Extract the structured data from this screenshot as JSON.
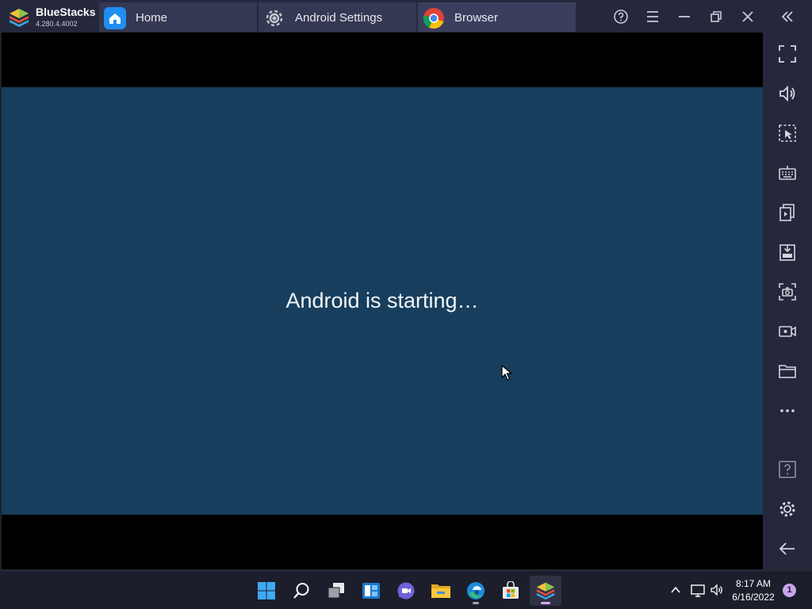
{
  "app": {
    "name": "BlueStacks",
    "version": "4.280.4.4002"
  },
  "tabs": [
    {
      "label": "Home",
      "icon": "home-icon"
    },
    {
      "label": "Android Settings",
      "icon": "gear-icon"
    },
    {
      "label": "Browser",
      "icon": "chrome-icon"
    }
  ],
  "window_controls": [
    "help-icon",
    "menu-icon",
    "minimize-icon",
    "restore-icon",
    "close-icon",
    "collapse-sidebar-icon"
  ],
  "screen": {
    "message": "Android is starting…"
  },
  "sidebar": [
    "fullscreen-icon",
    "volume-icon",
    "select-region-icon",
    "keyboard-icon",
    "multi-instance-icon",
    "apk-install-icon",
    "screenshot-icon",
    "record-icon",
    "folder-icon",
    "more-icon",
    "help-icon",
    "settings-icon",
    "back-icon"
  ],
  "taskbar": {
    "apps": [
      "start-icon",
      "search-icon",
      "task-view-icon",
      "widgets-icon",
      "teams-chat-icon",
      "file-explorer-icon",
      "edge-icon",
      "store-icon",
      "bluestacks-icon"
    ],
    "clock": {
      "time": "8:17 AM",
      "date": "6/16/2022"
    },
    "notification_count": "1"
  },
  "colors": {
    "titlebar": "#25283d",
    "boot_background": "#173f5d",
    "accent_chrome_red": "#db4437",
    "accent_chrome_yellow": "#f4c20d",
    "accent_chrome_green": "#0f9d58",
    "home_tab_blue": "#1f8ef1"
  }
}
